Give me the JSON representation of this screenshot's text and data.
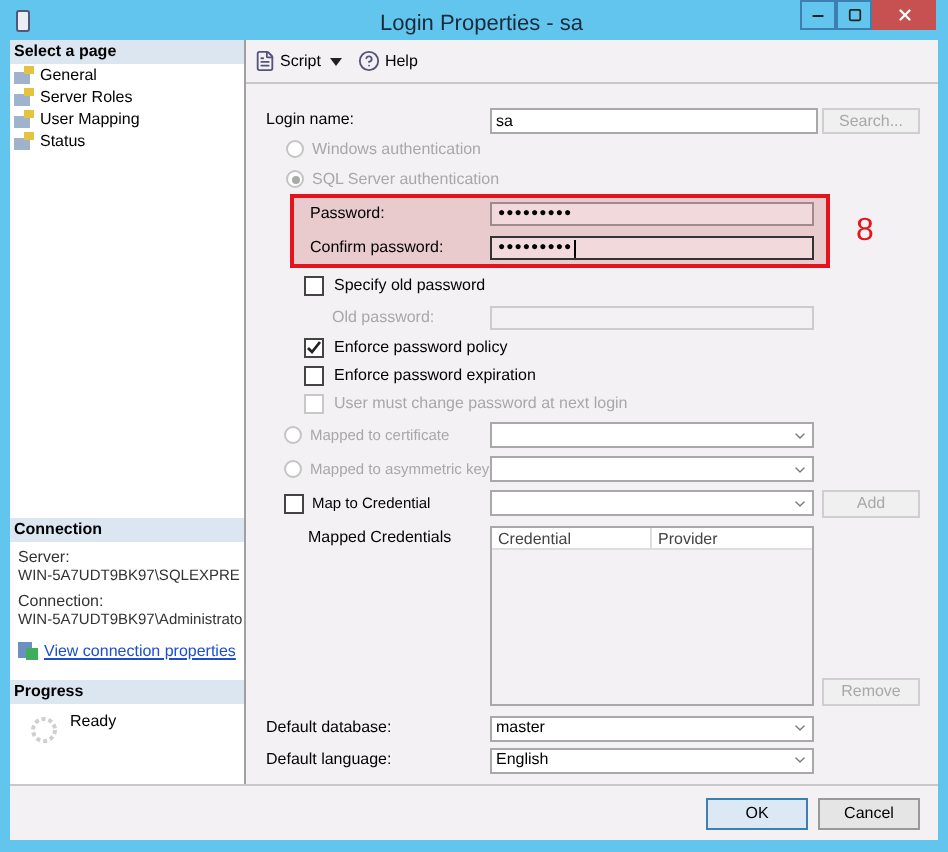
{
  "window": {
    "title": "Login Properties - sa"
  },
  "sidebar": {
    "header": "Select a page",
    "items": [
      {
        "label": "General"
      },
      {
        "label": "Server Roles"
      },
      {
        "label": "User Mapping"
      },
      {
        "label": "Status"
      }
    ]
  },
  "connection": {
    "header": "Connection",
    "server_label": "Server:",
    "server": "WIN-5A7UDT9BK97\\SQLEXPRE",
    "connection_label": "Connection:",
    "connection": "WIN-5A7UDT9BK97\\Administrato",
    "link": "View connection properties"
  },
  "progress": {
    "header": "Progress",
    "status": "Ready"
  },
  "toolbar": [
    {
      "label": "Script",
      "kind": "dropdown"
    },
    {
      "label": "Help",
      "kind": "button"
    }
  ],
  "login_name": {
    "label": "Login name:",
    "value": "sa",
    "search": {
      "label": "Search...",
      "disabled": true
    }
  },
  "auth_options": [
    {
      "label": "Windows authentication",
      "selected": false,
      "disabled": true
    },
    {
      "label": "SQL Server authentication",
      "selected": true,
      "disabled": true
    }
  ],
  "highlight": {
    "annotation": "8",
    "fields": [
      {
        "label": "Password:",
        "value": "●●●●●●●●●",
        "focused": false
      },
      {
        "label": "Confirm password:",
        "value": "●●●●●●●●●",
        "focused": true
      }
    ]
  },
  "specify_old": {
    "label": "Specify old password",
    "checked": false,
    "disabled": false
  },
  "old_password": {
    "label": "Old password:",
    "disabled": true
  },
  "policy_options": [
    {
      "label": "Enforce password policy",
      "checked": true,
      "disabled": false
    },
    {
      "label": "Enforce password expiration",
      "checked": false,
      "disabled": false
    },
    {
      "label": "User must change password at next login",
      "checked": false,
      "disabled": true
    }
  ],
  "mapping": [
    {
      "kind": "radio",
      "label": "Mapped to certificate",
      "selected": false,
      "disabled": true
    },
    {
      "kind": "radio",
      "label": "Mapped to asymmetric key",
      "selected": false,
      "disabled": true
    },
    {
      "kind": "checkbox",
      "label": "Map to Credential",
      "checked": false,
      "disabled": false
    }
  ],
  "add_button": {
    "label": "Add",
    "disabled": true
  },
  "mapped_credentials": {
    "label": "Mapped Credentials",
    "columns": [
      "Credential",
      "Provider"
    ],
    "remove": {
      "label": "Remove",
      "disabled": true
    }
  },
  "defaults": [
    {
      "label": "Default database:",
      "value": "master"
    },
    {
      "label": "Default language:",
      "value": "English"
    }
  ],
  "buttons": [
    {
      "label": "OK",
      "default": true
    },
    {
      "label": "Cancel",
      "default": false
    }
  ]
}
